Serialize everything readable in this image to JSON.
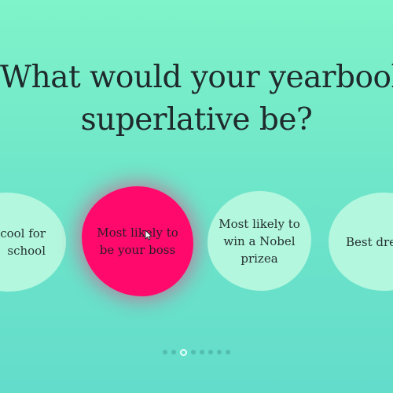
{
  "question": {
    "line1": "What would your yearbook",
    "line2": "superlative be?"
  },
  "options": [
    {
      "line1": "o cool for",
      "line2": "school"
    },
    {
      "line1": "Most likely to",
      "line2": "be your boss"
    },
    {
      "line1": "Most likely to",
      "line2": "win a Nobel",
      "line3": "prizea"
    },
    {
      "line1": "Best dres"
    }
  ],
  "pagination": {
    "count": 8,
    "active_index": 2
  },
  "colors": {
    "background_top": "#7ff3c9",
    "background_bottom": "#63dccb",
    "option": "#b3f7df",
    "option_selected": "#ff0a6c",
    "text": "#1f2a2c"
  }
}
